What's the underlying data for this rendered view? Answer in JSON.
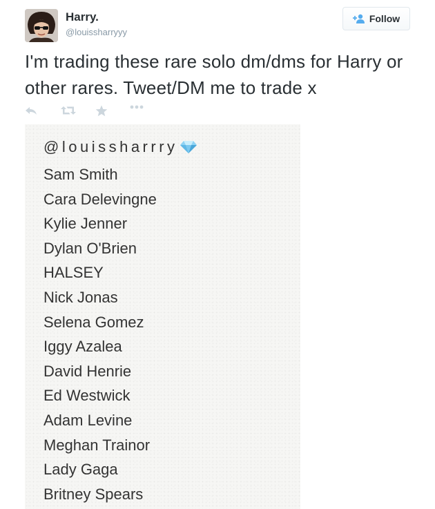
{
  "user": {
    "name": "Harry.",
    "handle": "@louissharryyy"
  },
  "follow": {
    "label": "Follow",
    "icon": "add-user-icon"
  },
  "tweet": {
    "text": "I'm trading these rare solo dm/dms for Harry or other rares. Tweet/DM me to trade x"
  },
  "actions": {
    "icons": [
      "reply-icon",
      "retweet-icon",
      "favorite-icon",
      "more-icon"
    ]
  },
  "image_card": {
    "handle": "@louissharrry",
    "emoji": "diamond-icon",
    "names": [
      "Sam Smith",
      "Cara Delevingne",
      "Kylie Jenner",
      "Dylan O'Brien",
      "HALSEY",
      "Nick Jonas",
      "Selena Gomez",
      "Iggy Azalea",
      "David Henrie",
      "Ed Westwick",
      "Adam Levine",
      "Meghan Trainor",
      "Lady Gaga",
      "Britney Spears"
    ]
  },
  "colors": {
    "text": "#292f33",
    "muted": "#8899a6",
    "accent": "#55acee",
    "card_bg": "#f6f6f4"
  }
}
